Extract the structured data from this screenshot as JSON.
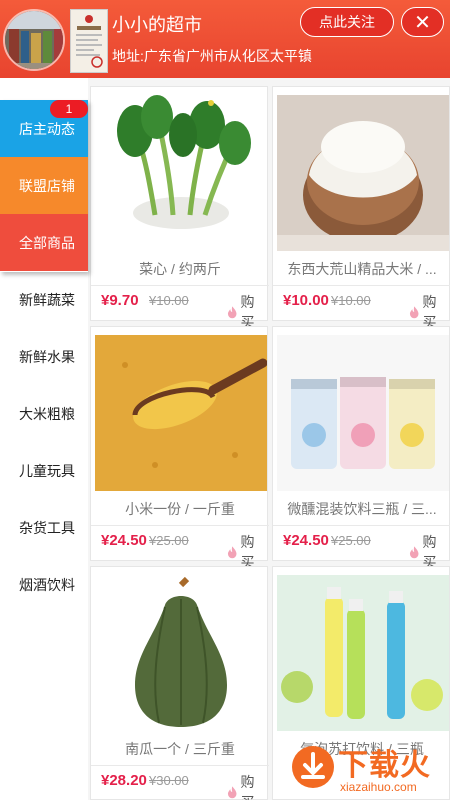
{
  "header": {
    "shop_name": "小小的超市",
    "address": "地址:广东省广州市从化区太平镇",
    "follow_label": "点此关注",
    "close_label": "✕"
  },
  "sidebar": {
    "items": [
      {
        "label": "店主动态",
        "bg": "#1aa3e6",
        "badge": "1"
      },
      {
        "label": "联盟店铺",
        "bg": "#f6892b"
      },
      {
        "label": "全部商品",
        "bg": "#ef4d3d"
      },
      {
        "label": "新鲜蔬菜"
      },
      {
        "label": "新鲜水果"
      },
      {
        "label": "大米粗粮"
      },
      {
        "label": "儿童玩具"
      },
      {
        "label": "杂货工具"
      },
      {
        "label": "烟酒饮料"
      }
    ]
  },
  "products": [
    {
      "title": "菜心 / 约两斤",
      "price": "¥9.70",
      "old_price": "¥10.00",
      "buy": "购买",
      "image": "vegetable-choy-sum"
    },
    {
      "title": "东西大荒山精品大米 / ...",
      "price": "¥10.00",
      "old_price": "¥10.00",
      "buy": "购买",
      "image": "rice-bowl"
    },
    {
      "title": "小米一份 / 一斤重",
      "price": "¥24.50",
      "old_price": "¥25.00",
      "buy": "购买",
      "image": "millet-scoop"
    },
    {
      "title": "微醺混装饮料三瓶 / 三...",
      "price": "¥24.50",
      "old_price": "¥25.00",
      "buy": "购买",
      "image": "rio-cans"
    },
    {
      "title": "南瓜一个 / 三斤重",
      "price": "¥28.20",
      "old_price": "¥30.00",
      "buy": "购买",
      "image": "pumpkin"
    },
    {
      "title": "气泡苏打饮料 / 三瓶",
      "price": "",
      "old_price": "",
      "buy": "",
      "image": "soda-bottles"
    }
  ],
  "watermark": {
    "text": "下载火",
    "url": "xiazaihuo.com"
  },
  "colors": {
    "header": "#e8442f",
    "price": "#e4204a",
    "accent": "#ec1c24"
  }
}
